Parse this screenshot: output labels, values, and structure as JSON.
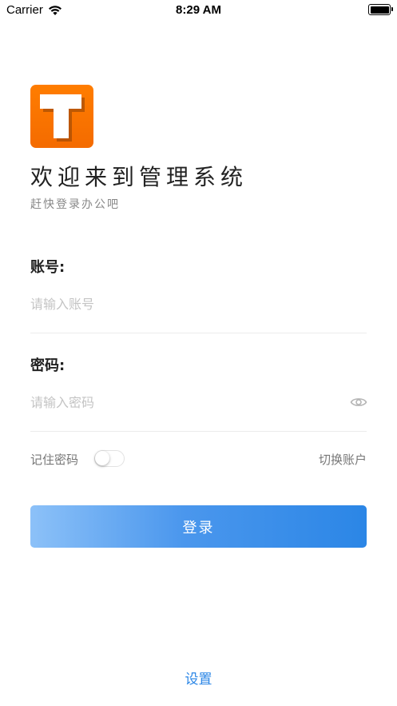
{
  "status_bar": {
    "carrier": "Carrier",
    "time": "8:29 AM"
  },
  "header": {
    "logo_letter": "T",
    "title": "欢迎来到管理系统",
    "subtitle": "赶快登录办公吧"
  },
  "form": {
    "account_label": "账号:",
    "account_placeholder": "请输入账号",
    "account_value": "",
    "password_label": "密码:",
    "password_placeholder": "请输入密码",
    "password_value": "",
    "remember_label": "记住密码",
    "remember_on": false,
    "switch_account": "切换账户"
  },
  "actions": {
    "login_label": "登录",
    "settings_label": "设置"
  },
  "colors": {
    "accent": "#2b86e6",
    "logo_orange": "#f46b00"
  }
}
